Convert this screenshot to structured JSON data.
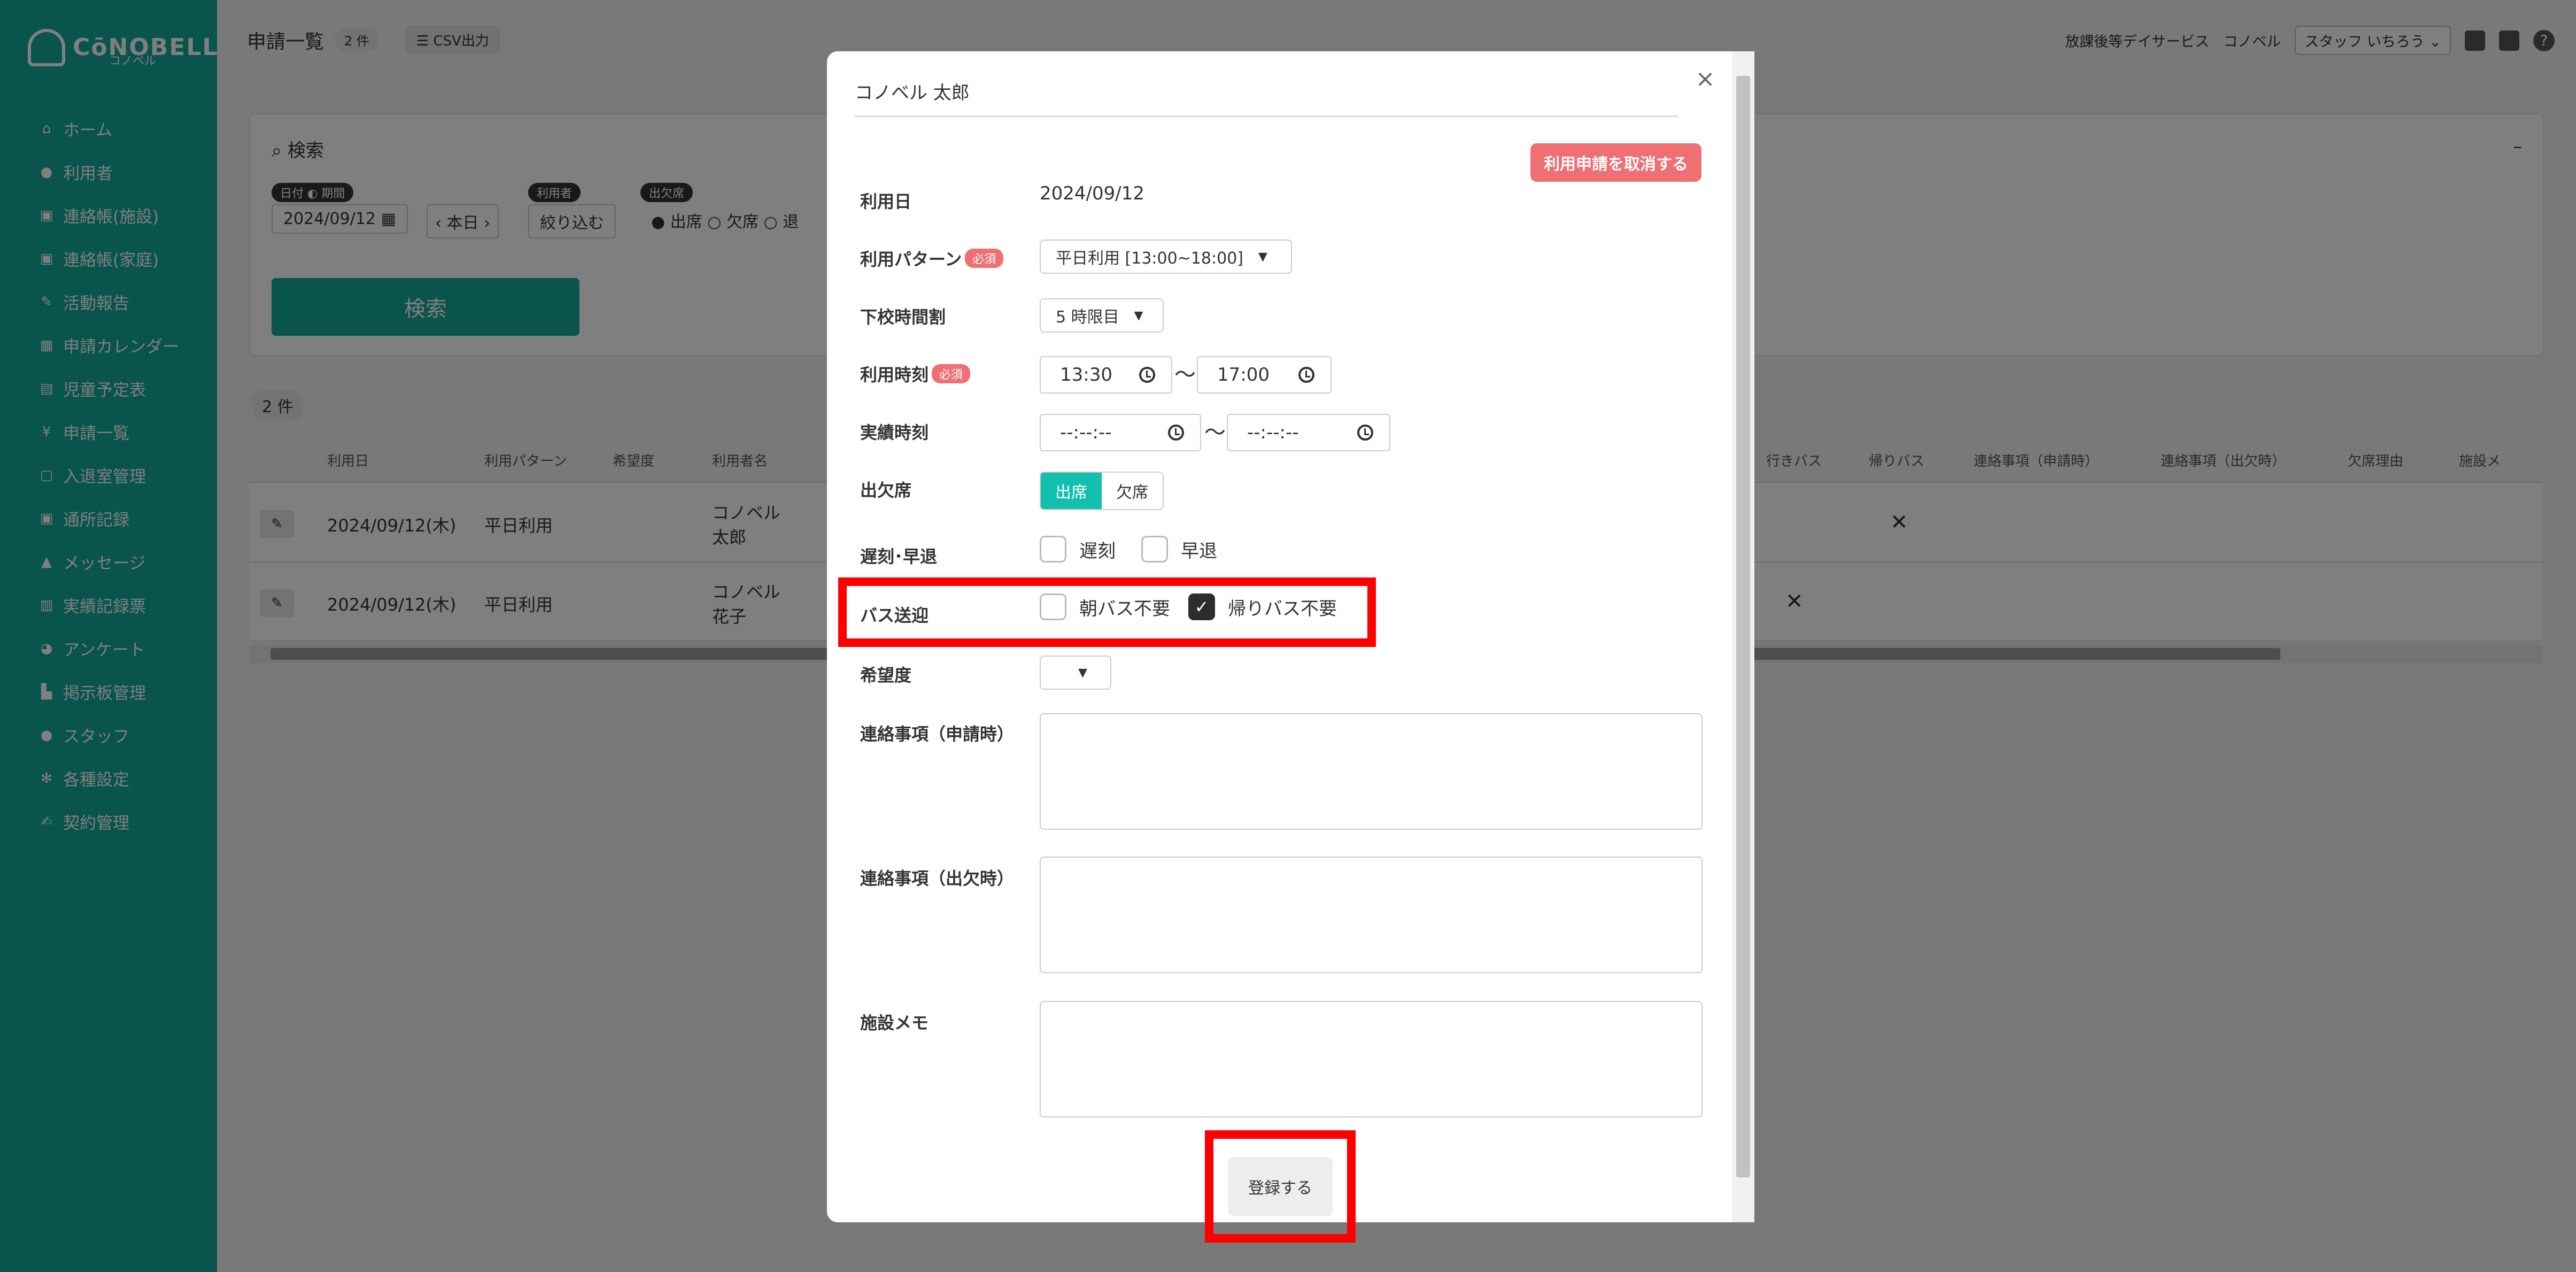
{
  "sidebar": {
    "logo_text": "CōNOBELL",
    "logo_sub": "コノベル",
    "items": [
      {
        "label": "ホーム",
        "icon": "home-icon"
      },
      {
        "label": "利用者",
        "icon": "users-icon"
      },
      {
        "label": "連絡帳(施設)",
        "icon": "contact-book-icon"
      },
      {
        "label": "連絡帳(家庭)",
        "icon": "contact-book-icon"
      },
      {
        "label": "活動報告",
        "icon": "edit-icon"
      },
      {
        "label": "申請カレンダー",
        "icon": "calendar-icon"
      },
      {
        "label": "児童予定表",
        "icon": "schedule-icon"
      },
      {
        "label": "申請一覧",
        "icon": "list-icon"
      },
      {
        "label": "入退室管理",
        "icon": "door-icon"
      },
      {
        "label": "通所記録",
        "icon": "record-icon"
      },
      {
        "label": "メッセージ",
        "icon": "bell-icon"
      },
      {
        "label": "実績記録票",
        "icon": "table-icon"
      },
      {
        "label": "アンケート",
        "icon": "chart-icon"
      },
      {
        "label": "掲示板管理",
        "icon": "board-icon"
      },
      {
        "label": "スタッフ",
        "icon": "staff-icon"
      },
      {
        "label": "各種設定",
        "icon": "gear-icon"
      },
      {
        "label": "契約管理",
        "icon": "contract-icon"
      }
    ]
  },
  "header": {
    "title": "申請一覧",
    "count": "2 件",
    "csv": "CSV出力",
    "service": "放課後等デイサービス",
    "facility": "コノベル",
    "staff": "スタッフ いちろう"
  },
  "search": {
    "title": "検索",
    "collapse": "–",
    "chip_date": "日付",
    "chip_period": "期間",
    "chip_user": "利用者",
    "chip_attendance": "出欠席",
    "date_value": "2024/09/12",
    "today": "本日",
    "filter": "絞り込む",
    "opt_present": "出席",
    "opt_absent": "欠席",
    "opt_other": "退",
    "button": "検索"
  },
  "results": {
    "count": "2 件",
    "columns": [
      "利用日",
      "利用パターン",
      "希望度",
      "利用者名",
      "行きバス",
      "帰りバス",
      "連絡事項（申請時）",
      "連絡事項（出欠時）",
      "欠席理由",
      "施設メ"
    ],
    "rows": [
      {
        "date": "2024/09/12(木)",
        "pattern": "平日利用",
        "name": "コノベル 太郎",
        "mark": "✕"
      },
      {
        "date": "2024/09/12(木)",
        "pattern": "平日利用",
        "name": "コノベル 花子",
        "mark": "✕"
      }
    ]
  },
  "modal": {
    "title": "コノベル 太郎",
    "close": "×",
    "cancel_label": "利用申請を取消する",
    "required": "必須",
    "date_label": "利用日",
    "date_value": "2024/09/12",
    "pattern_label": "利用パターン",
    "pattern_value": "平日利用 [13:00~18:00]",
    "school_label": "下校時間割",
    "school_value": "5 時限目",
    "time_label": "利用時刻",
    "time_start": "13:30",
    "time_end": "17:00",
    "actual_label": "実績時刻",
    "actual_start": "--:--:--",
    "actual_end": "--:--:--",
    "tilde": "〜",
    "attendance_label": "出欠席",
    "attend_present": "出席",
    "attend_absent": "欠席",
    "late_label": "遅刻･早退",
    "late": "遅刻",
    "early": "早退",
    "bus_label": "バス送迎",
    "bus_morning": "朝バス不要",
    "bus_return": "帰りバス不要",
    "check_mark": "✓",
    "wish_label": "希望度",
    "note_apply_label": "連絡事項（申請時）",
    "note_attend_label": "連絡事項（出欠時）",
    "memo_label": "施設メモ",
    "submit": "登録する"
  },
  "colors": {
    "sidebar": "#13a89a",
    "accent": "#13bfae",
    "danger": "#ef6f73",
    "highlight": "#ff0000"
  }
}
